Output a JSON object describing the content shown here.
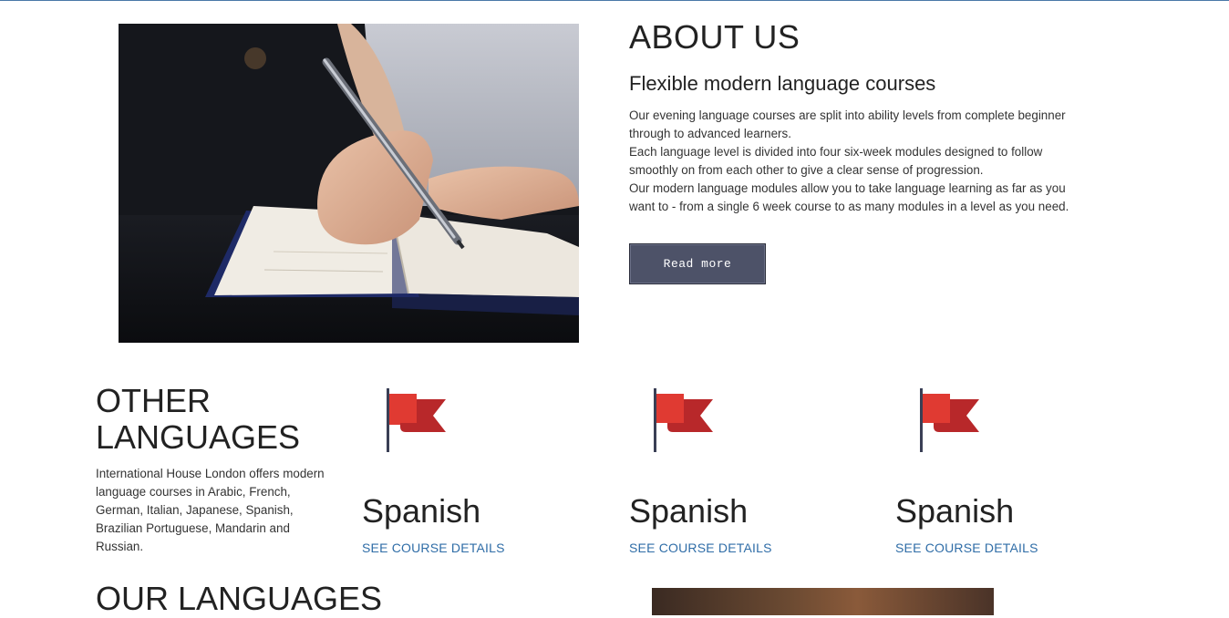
{
  "about": {
    "title": "ABOUT US",
    "subtitle": "Flexible modern language courses",
    "paragraphs": [
      "Our evening language courses are split into ability levels from complete beginner through to advanced learners.",
      "Each language level is divided into four six-week modules designed to follow smoothly on from each other to give a clear sense of progression.",
      "Our modern language modules allow you to take language learning as far as you want to - from a single 6 week course to as many modules in a level as you need."
    ],
    "read_more_label": "Read more",
    "button_color": "#4d5268"
  },
  "other": {
    "title_line1": "OTHER",
    "title_line2": "LANGUAGES",
    "text": "International House London offers modern language courses in Arabic, French, German, Italian, Japanese, Spanish, Brazilian Portuguese, Mandarin and Russian."
  },
  "courses": [
    {
      "name": "Spanish",
      "link_label": "SEE COURSE DETAILS",
      "icon": "flag-icon"
    },
    {
      "name": "Spanish",
      "link_label": "SEE COURSE DETAILS",
      "icon": "flag-icon"
    },
    {
      "name": "Spanish",
      "link_label": "SEE COURSE DETAILS",
      "icon": "flag-icon"
    }
  ],
  "our_languages": {
    "title": "OUR LANGUAGES"
  },
  "colors": {
    "link": "#2f6da7",
    "flag_red": "#e03a32",
    "flag_dark": "#b8282a",
    "pole": "#3a3f55"
  }
}
